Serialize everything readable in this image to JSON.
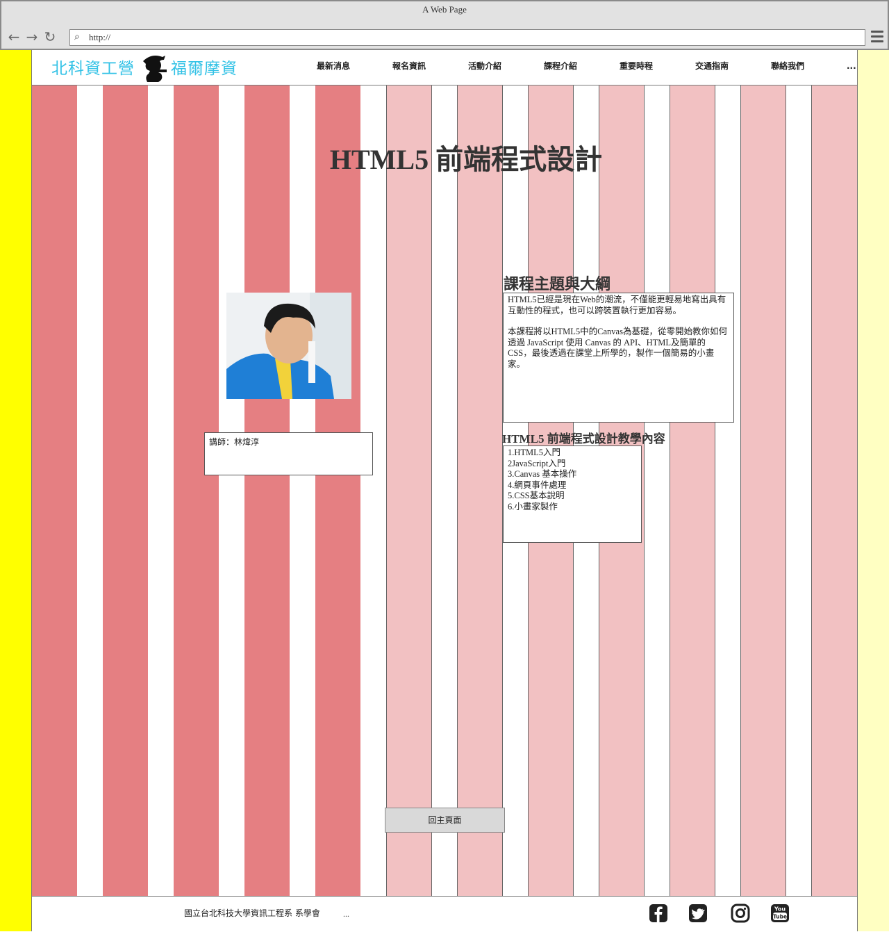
{
  "browser": {
    "title": "A Web Page",
    "url": "http://"
  },
  "header": {
    "logo_left": "北科資工營",
    "logo_right": "福爾摩資",
    "nav": [
      "最新消息",
      "報名資訊",
      "活動介紹",
      "課程介紹",
      "重要時程",
      "交通指南",
      "聯絡我們"
    ],
    "nav_more": "..."
  },
  "main": {
    "title": "HTML5 前端程式設計",
    "instructor": "講師：林煒淳",
    "topic_heading": "課程主題與大綱",
    "topic_p1": "HTML5已經是現在Web的潮流，不僅能更輕易地寫出具有互動性的程式，也可以跨裝置執行更加容易。",
    "topic_p2": "本課程將以HTML5中的Canvas為基礎，從零開始教你如何透過 JavaScript 使用 Canvas 的 API、HTML及簡單的CSS，最後透過在課堂上所學的，製作一個簡易的小畫家。",
    "contents_heading": "HTML5 前端程式設計教學內容",
    "contents": [
      "1.HTML5入門",
      "2JavaScript入門",
      "3.Canvas 基本操作",
      "4.網頁事件處理",
      "5.CSS基本說明",
      "6.小畫家製作"
    ],
    "back_button": "回主頁面"
  },
  "footer": {
    "text": "國立台北科技大學資訊工程系 系學會",
    "more": "...",
    "social": [
      "facebook-icon",
      "twitter-icon",
      "instagram-icon",
      "youtube-icon"
    ]
  },
  "colors": {
    "left_panel": "#ffff00",
    "right_panel": "#ffffc2",
    "stripe_dark": "#e57f82",
    "stripe_light": "#f2c1c2",
    "logo_text": "#33c2e6"
  }
}
